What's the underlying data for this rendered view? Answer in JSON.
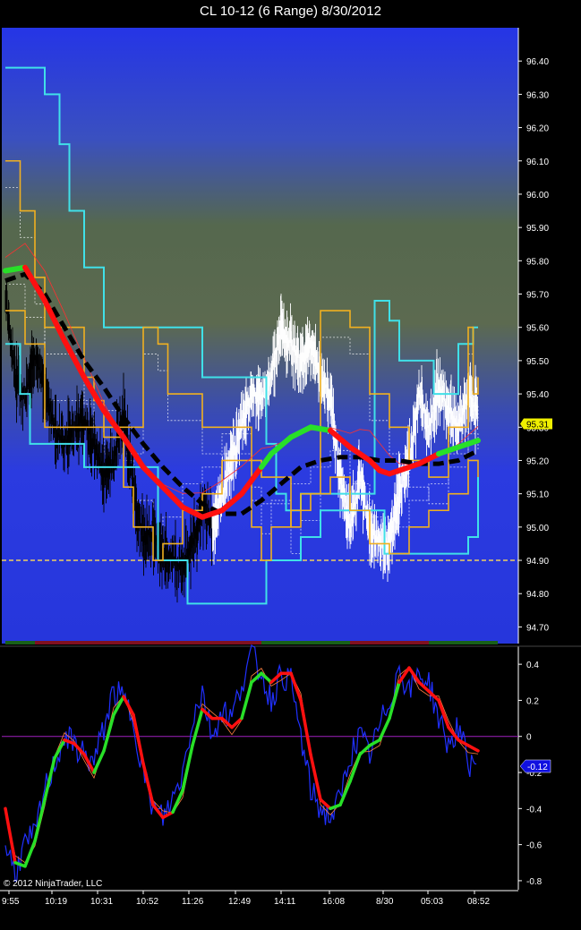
{
  "window": {
    "title": "CL 10-12 (6 Range)  8/30/2012"
  },
  "copyright": "© 2012 NinjaTrader, LLC",
  "colors": {
    "background": "#000000",
    "panel_top": "#2a3ce0",
    "panel_mid": "#5a7050",
    "panel_bottom": "#2c3bd8",
    "bands_outer": "#40e0e8",
    "bands_inner": "#f0b020",
    "price_bars_early": "#000000",
    "price_bars_late": "#ffffff",
    "trend_up": "#28e028",
    "trend_down": "#ff1010",
    "slow_ma": "#000000",
    "support_line": "#f0d060",
    "zero_line": "#a020c0",
    "osc_raw": "#2030ff",
    "price_badge": "#f0f000",
    "osc_badge": "#1010e0"
  },
  "chart_data": [
    {
      "type": "line",
      "name": "price-panel",
      "title": "CL 10-12 (6 Range)  8/30/2012",
      "ylim": [
        94.65,
        96.5
      ],
      "yticks": [
        "96.40",
        "96.30",
        "96.20",
        "96.10",
        "96.00",
        "95.90",
        "95.80",
        "95.70",
        "95.60",
        "95.50",
        "95.40",
        "95.30",
        "95.20",
        "95.10",
        "95.00",
        "94.90",
        "94.80",
        "94.70"
      ],
      "last_price": "95.31",
      "support_level": 94.9,
      "x_categories": [
        "9:55",
        "10:19",
        "10:31",
        "10:52",
        "11:26",
        "12:49",
        "14:11",
        "16:08",
        "8/30",
        "05:03",
        "08:52"
      ],
      "x_range": [
        0,
        100
      ],
      "series": [
        {
          "name": "",
          "role": "upper-outer-band",
          "x": [
            0,
            6,
            8,
            11,
            13,
            16,
            20,
            25,
            28,
            38,
            40,
            53,
            55,
            57,
            60,
            75,
            78,
            80,
            87,
            92,
            95,
            96
          ],
          "y": [
            96.38,
            96.38,
            96.3,
            96.15,
            95.95,
            95.78,
            95.6,
            95.6,
            95.6,
            95.6,
            95.45,
            95.25,
            95.1,
            95.05,
            95.1,
            95.68,
            95.62,
            95.5,
            95.4,
            95.55,
            95.6,
            95.6
          ]
        },
        {
          "name": "",
          "role": "lower-outer-band",
          "x": [
            0,
            3,
            5,
            10,
            14,
            16,
            25,
            31,
            37,
            38,
            40,
            53,
            58,
            60,
            64,
            70,
            75,
            77,
            82,
            86,
            90,
            94,
            96
          ],
          "y": [
            95.55,
            95.4,
            95.25,
            95.25,
            95.25,
            95.18,
            95.18,
            94.9,
            94.77,
            94.77,
            94.77,
            94.9,
            94.9,
            94.97,
            95.05,
            95.05,
            95.05,
            94.92,
            94.92,
            94.92,
            94.92,
            94.97,
            95.15
          ]
        },
        {
          "name": "",
          "role": "upper-inner-band",
          "x": [
            0,
            3,
            6,
            8,
            11,
            16,
            18,
            20,
            28,
            31,
            33,
            40,
            45,
            50,
            52,
            58,
            60,
            64,
            70,
            74,
            78,
            82,
            86,
            90,
            94,
            95,
            96
          ],
          "y": [
            96.1,
            95.95,
            95.75,
            95.6,
            95.6,
            95.45,
            95.38,
            95.3,
            95.6,
            95.55,
            95.4,
            95.3,
            95.3,
            95.2,
            95.15,
            95.0,
            95.1,
            95.65,
            95.6,
            95.4,
            95.3,
            95.2,
            95.15,
            95.3,
            95.6,
            95.4,
            95.45
          ]
        },
        {
          "name": "",
          "role": "lower-inner-band",
          "x": [
            0,
            4,
            8,
            12,
            16,
            20,
            24,
            26,
            30,
            32,
            36,
            40,
            44,
            48,
            50,
            52,
            54,
            58,
            62,
            66,
            70,
            74,
            78,
            82,
            86,
            90,
            94,
            96
          ],
          "y": [
            95.65,
            95.55,
            95.3,
            95.3,
            95.3,
            95.27,
            95.12,
            95.0,
            94.9,
            94.95,
            95.05,
            95.1,
            95.2,
            95.2,
            95.0,
            94.9,
            95.0,
            95.05,
            95.1,
            95.15,
            95.05,
            94.95,
            94.92,
            95.0,
            95.05,
            95.1,
            95.2,
            95.15
          ]
        },
        {
          "name": "",
          "role": "price",
          "x": [
            0,
            2,
            4,
            6,
            8,
            10,
            12,
            14,
            16,
            18,
            20,
            22,
            24,
            26,
            28,
            30,
            32,
            34,
            36,
            38,
            40,
            42,
            44,
            46,
            48,
            50,
            52,
            54,
            56,
            58,
            60,
            62,
            64,
            66,
            68,
            70,
            72,
            74,
            76,
            78,
            80,
            82,
            84,
            86,
            88,
            90,
            92,
            94,
            96
          ],
          "y": [
            95.7,
            95.45,
            95.38,
            95.52,
            95.42,
            95.3,
            95.25,
            95.3,
            95.32,
            95.25,
            95.15,
            95.2,
            95.35,
            95.1,
            94.97,
            94.98,
            94.92,
            94.9,
            94.88,
            94.95,
            95.05,
            95.0,
            95.1,
            95.2,
            95.3,
            95.4,
            95.38,
            95.45,
            95.6,
            95.55,
            95.5,
            95.55,
            95.45,
            95.4,
            95.15,
            95.0,
            95.15,
            95.0,
            94.95,
            94.95,
            95.1,
            95.2,
            95.4,
            95.3,
            95.42,
            95.35,
            95.3,
            95.4,
            95.33
          ]
        },
        {
          "name": "",
          "role": "trend-ma",
          "x": [
            0,
            4,
            8,
            12,
            16,
            20,
            24,
            28,
            32,
            36,
            40,
            44,
            48,
            52,
            54,
            58,
            62,
            66,
            70,
            72,
            74,
            76,
            78,
            80,
            84,
            88,
            92,
            96
          ],
          "y": [
            95.77,
            95.78,
            95.68,
            95.56,
            95.45,
            95.35,
            95.27,
            95.18,
            95.12,
            95.06,
            95.03,
            95.05,
            95.1,
            95.18,
            95.22,
            95.27,
            95.3,
            95.29,
            95.24,
            95.22,
            95.2,
            95.17,
            95.16,
            95.17,
            95.19,
            95.22,
            95.24,
            95.26
          ],
          "up_segments": [
            [
              0,
              4
            ],
            [
              52,
              66
            ],
            [
              88,
              96
            ]
          ]
        },
        {
          "name": "",
          "role": "slow-ma",
          "x": [
            0,
            4,
            8,
            12,
            16,
            20,
            24,
            28,
            32,
            36,
            40,
            44,
            48,
            52,
            56,
            60,
            64,
            68,
            72,
            76,
            80,
            84,
            88,
            92,
            96
          ],
          "y": [
            95.74,
            95.76,
            95.7,
            95.6,
            95.5,
            95.42,
            95.33,
            95.25,
            95.18,
            95.12,
            95.07,
            95.04,
            95.04,
            95.08,
            95.13,
            95.18,
            95.2,
            95.21,
            95.21,
            95.2,
            95.2,
            95.19,
            95.19,
            95.2,
            95.23
          ]
        }
      ]
    },
    {
      "type": "line",
      "name": "oscillator-panel",
      "ylim": [
        -0.85,
        0.48
      ],
      "yticks": [
        "0.4",
        "0.2",
        "0",
        "-0.2",
        "-0.4",
        "-0.6",
        "-0.8"
      ],
      "last_value": "-0.12",
      "series": [
        {
          "name": "",
          "role": "raw-osc",
          "x": [
            0,
            2,
            4,
            6,
            8,
            10,
            12,
            14,
            16,
            18,
            20,
            22,
            24,
            26,
            28,
            30,
            32,
            34,
            36,
            38,
            40,
            42,
            44,
            46,
            48,
            50,
            52,
            54,
            56,
            58,
            60,
            62,
            64,
            66,
            68,
            70,
            72,
            74,
            76,
            78,
            80,
            82,
            84,
            86,
            88,
            90,
            92,
            94,
            96
          ],
          "y": [
            -0.6,
            -0.75,
            -0.6,
            -0.55,
            -0.3,
            -0.15,
            0.0,
            -0.05,
            -0.1,
            -0.15,
            0.05,
            0.25,
            0.2,
            0.1,
            -0.2,
            -0.4,
            -0.45,
            -0.35,
            -0.2,
            0.1,
            0.25,
            0.0,
            0.15,
            0.1,
            0.3,
            0.45,
            0.35,
            0.2,
            0.35,
            0.3,
            0.0,
            -0.3,
            -0.4,
            -0.45,
            -0.35,
            -0.1,
            0.0,
            -0.1,
            0.05,
            0.2,
            0.38,
            0.25,
            0.35,
            0.3,
            0.1,
            -0.05,
            0.05,
            -0.15,
            -0.12
          ]
        },
        {
          "name": "",
          "role": "smooth-osc",
          "x": [
            0,
            2,
            4,
            6,
            8,
            10,
            12,
            14,
            16,
            18,
            20,
            22,
            24,
            26,
            28,
            30,
            32,
            34,
            36,
            38,
            40,
            42,
            44,
            46,
            48,
            50,
            52,
            54,
            56,
            58,
            60,
            62,
            64,
            66,
            68,
            70,
            72,
            74,
            76,
            78,
            80,
            82,
            84,
            86,
            88,
            90,
            92,
            94,
            96
          ],
          "y": [
            -0.4,
            -0.7,
            -0.72,
            -0.58,
            -0.35,
            -0.12,
            -0.02,
            -0.04,
            -0.1,
            -0.2,
            -0.08,
            0.12,
            0.22,
            0.12,
            -0.15,
            -0.38,
            -0.45,
            -0.42,
            -0.3,
            -0.05,
            0.15,
            0.1,
            0.1,
            0.05,
            0.1,
            0.3,
            0.35,
            0.3,
            0.35,
            0.35,
            0.2,
            -0.1,
            -0.35,
            -0.4,
            -0.38,
            -0.25,
            -0.1,
            -0.05,
            -0.02,
            0.1,
            0.3,
            0.38,
            0.3,
            0.25,
            0.2,
            0.05,
            -0.02,
            -0.05,
            -0.08
          ],
          "up_segments": [
            [
              2,
              12
            ],
            [
              18,
              24
            ],
            [
              34,
              40
            ],
            [
              48,
              54
            ],
            [
              66,
              80
            ]
          ]
        }
      ]
    }
  ]
}
